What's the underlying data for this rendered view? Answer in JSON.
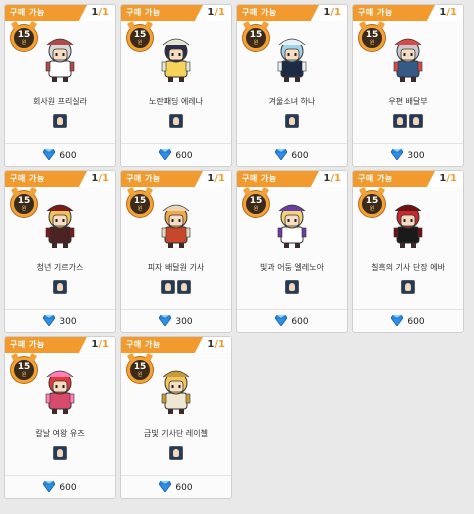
{
  "cards": [
    {
      "tag": "구매 가능",
      "count": "1",
      "max": "1",
      "level": "15",
      "unit": "원",
      "name": "회사원 프리실라",
      "price": "600",
      "icons": 1,
      "colors": {
        "body": "#ffffff",
        "hair": "#d7d7d7",
        "accent": "#b04a4a"
      }
    },
    {
      "tag": "구매 가능",
      "count": "1",
      "max": "1",
      "level": "15",
      "unit": "원",
      "name": "노란패딩 에레나",
      "price": "600",
      "icons": 1,
      "colors": {
        "body": "#f6d35a",
        "hair": "#2d2d4a",
        "accent": "#e6e6d6"
      }
    },
    {
      "tag": "구매 가능",
      "count": "1",
      "max": "1",
      "level": "15",
      "unit": "원",
      "name": "겨울소녀 하나",
      "price": "600",
      "icons": 1,
      "colors": {
        "body": "#1e2b44",
        "hair": "#9fd3ea",
        "accent": "#e7f2f7"
      }
    },
    {
      "tag": "구매 가능",
      "count": "1",
      "max": "1",
      "level": "15",
      "unit": "원",
      "name": "우편 배달부",
      "price": "300",
      "icons": 2,
      "colors": {
        "body": "#365a86",
        "hair": "#c7c7d2",
        "accent": "#d64a4a"
      }
    },
    {
      "tag": "구매 가능",
      "count": "1",
      "max": "1",
      "level": "15",
      "unit": "원",
      "name": "청년 기르가스",
      "price": "300",
      "icons": 1,
      "colors": {
        "body": "#4b2323",
        "hair": "#f1c15e",
        "accent": "#7a1b1b"
      }
    },
    {
      "tag": "구매 가능",
      "count": "1",
      "max": "1",
      "level": "15",
      "unit": "원",
      "name": "피자 배달원 기사",
      "price": "300",
      "icons": 2,
      "colors": {
        "body": "#c6472b",
        "hair": "#f2a84a",
        "accent": "#e8d6b6"
      }
    },
    {
      "tag": "구매 가능",
      "count": "1",
      "max": "1",
      "level": "15",
      "unit": "원",
      "name": "빛과 어둠 엘레노아",
      "price": "600",
      "icons": 1,
      "colors": {
        "body": "#ffffff",
        "hair": "#f5d57a",
        "accent": "#6a3da0"
      }
    },
    {
      "tag": "구매 가능",
      "count": "1",
      "max": "1",
      "level": "15",
      "unit": "원",
      "name": "칠흑의 기사 단장 에바",
      "price": "600",
      "icons": 1,
      "colors": {
        "body": "#1a1a1a",
        "hair": "#c8272c",
        "accent": "#6b1216"
      }
    },
    {
      "tag": "구매 가능",
      "count": "1",
      "max": "1",
      "level": "15",
      "unit": "원",
      "name": "칼날 여왕 유즈",
      "price": "600",
      "icons": 1,
      "colors": {
        "body": "#d94b6c",
        "hair": "#e03a3a",
        "accent": "#ff7fb8"
      }
    },
    {
      "tag": "구매 가능",
      "count": "1",
      "max": "1",
      "level": "15",
      "unit": "원",
      "name": "금빛 기사단 레이첼",
      "price": "600",
      "icons": 1,
      "colors": {
        "body": "#efe7d3",
        "hair": "#f0c85a",
        "accent": "#c79a3b"
      }
    }
  ]
}
